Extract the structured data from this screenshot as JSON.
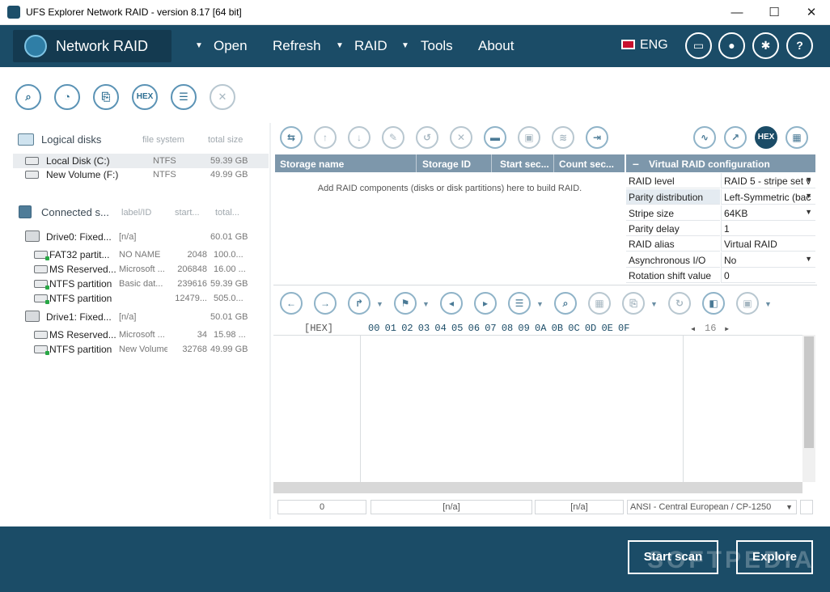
{
  "window": {
    "title": "UFS Explorer Network RAID - version 8.17 [64 bit]",
    "minimize": "—",
    "maximize": "☐",
    "close": "✕"
  },
  "menubar": {
    "brand": "Network RAID",
    "open": "Open",
    "refresh": "Refresh",
    "raid": "RAID",
    "tools": "Tools",
    "about": "About",
    "lang": "ENG",
    "arrow": "▼"
  },
  "left": {
    "logical_title": "Logical disks",
    "logical_cols": [
      "file system",
      "total size"
    ],
    "logical_rows": [
      {
        "name": "Local Disk (C:)",
        "fs": "NTFS",
        "size": "59.39 GB"
      },
      {
        "name": "New Volume (F:)",
        "fs": "NTFS",
        "size": "49.99 GB"
      }
    ],
    "connected_title": "Connected s...",
    "connected_cols": [
      "label/ID",
      "start...",
      "total..."
    ],
    "drive0": {
      "name": "Drive0: Fixed...",
      "label": "[n/a]",
      "total": "60.01 GB"
    },
    "drive0_parts": [
      {
        "name": "FAT32 partit...",
        "label": "NO NAME",
        "start": "2048",
        "total": "100.0..."
      },
      {
        "name": "MS Reserved...",
        "label": "Microsoft ...",
        "start": "206848",
        "total": "16.00 ..."
      },
      {
        "name": "NTFS partition",
        "label": "Basic dat...",
        "start": "239616",
        "total": "59.39 GB"
      },
      {
        "name": "NTFS partition",
        "label": "",
        "start": "12479...",
        "total": "505.0..."
      }
    ],
    "drive1": {
      "name": "Drive1: Fixed...",
      "label": "[n/a]",
      "total": "50.01 GB"
    },
    "drive1_parts": [
      {
        "name": "MS Reserved...",
        "label": "Microsoft ...",
        "start": "34",
        "total": "15.98 ..."
      },
      {
        "name": "NTFS partition",
        "label": "New Volume",
        "start": "32768",
        "total": "49.99 GB"
      }
    ]
  },
  "storage_grid": {
    "cols": [
      "Storage name",
      "Storage ID",
      "Start sec...",
      "Count sec..."
    ],
    "empty_text": "Add RAID components (disks or disk partitions) here to build RAID."
  },
  "raid_config": {
    "header_symbol": "–",
    "title": "Virtual RAID configuration",
    "rows": [
      {
        "k": "RAID level",
        "v": "RAID 5 - stripe set v",
        "dd": "▼"
      },
      {
        "k": "Parity distribution",
        "v": "Left-Symmetric (bac",
        "dd": "▼"
      },
      {
        "k": "Stripe size",
        "v": "64KB",
        "dd": "▼"
      },
      {
        "k": "Parity delay",
        "v": "1",
        "dd": ""
      },
      {
        "k": "RAID alias",
        "v": "Virtual RAID",
        "dd": ""
      },
      {
        "k": "Asynchronous I/O",
        "v": "No",
        "dd": "▼"
      },
      {
        "k": "Rotation shift value",
        "v": "0",
        "dd": ""
      }
    ]
  },
  "hex": {
    "label": "[HEX]",
    "columns": "00 01 02 03 04 05 06 07 08 09 0A 0B 0C 0D 0E 0F",
    "width_left": "◂",
    "width": "16",
    "width_right": "▸"
  },
  "statusbar": {
    "offset": "0",
    "f2": "[n/a]",
    "f3": "[n/a]",
    "encoding": "ANSI - Central European / CP-1250"
  },
  "footer": {
    "start_scan": "Start scan",
    "explore": "Explore",
    "watermark": "SOFTPEDIA"
  },
  "colors": {
    "accent": "#1b4c67",
    "grid_header": "#7d97ab"
  }
}
